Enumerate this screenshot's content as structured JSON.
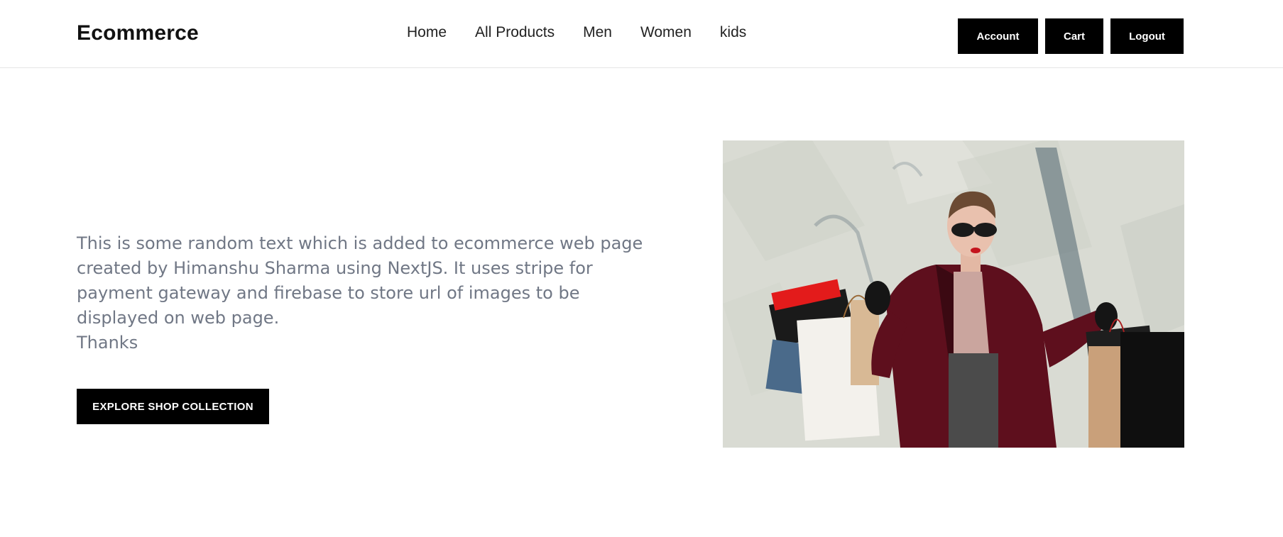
{
  "header": {
    "logo": "Ecommerce",
    "nav": [
      {
        "label": "Home"
      },
      {
        "label": "All Products"
      },
      {
        "label": "Men"
      },
      {
        "label": "Women"
      },
      {
        "label": "kids"
      }
    ],
    "actions": {
      "account": "Account",
      "cart": "Cart",
      "logout": "Logout"
    }
  },
  "hero": {
    "description": "This is some random text which is added to ecommerce web page created by Himanshu Sharma using NextJS. It uses stripe for payment gateway and firebase to store url of images to be displayed on web page.",
    "thanks": "Thanks",
    "cta": "EXPLORE SHOP COLLECTION"
  },
  "colors": {
    "primary": "#000000",
    "text_muted": "#707785",
    "border": "#e5e5e5"
  }
}
